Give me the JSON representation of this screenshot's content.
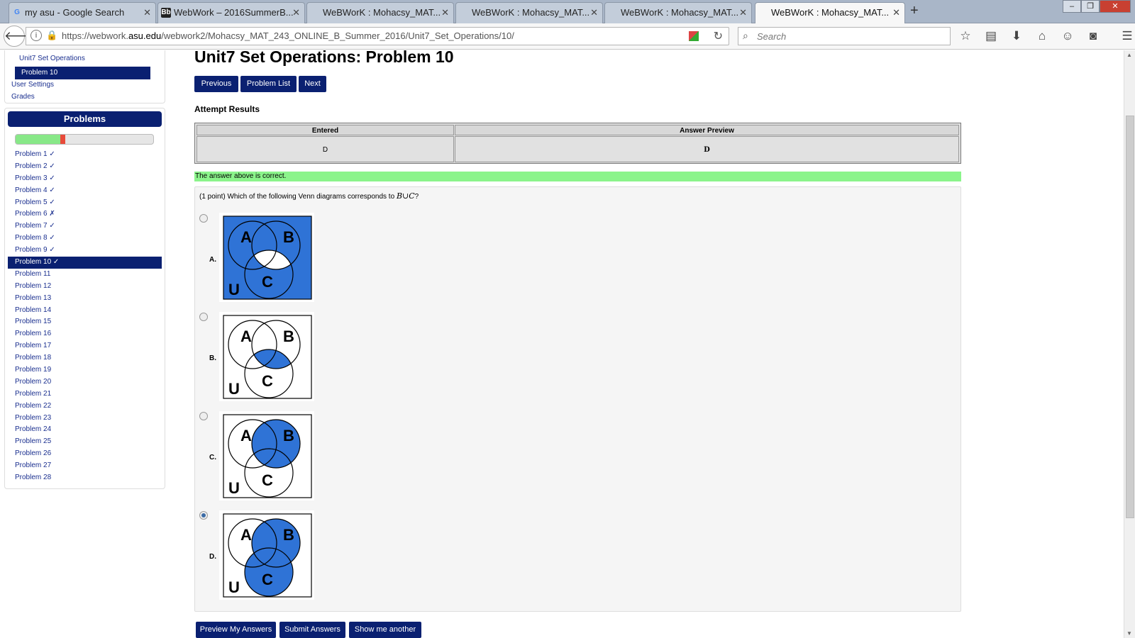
{
  "browser": {
    "tabs": [
      {
        "title": "my asu - Google Search",
        "favicon": "google-icon",
        "active": false
      },
      {
        "title": "WebWork – 2016SummerB...",
        "favicon": "blackboard-icon",
        "active": false
      },
      {
        "title": "WeBWorK : Mohacsy_MAT...",
        "favicon": "none",
        "active": false
      },
      {
        "title": "WeBWorK : Mohacsy_MAT...",
        "favicon": "none",
        "active": false
      },
      {
        "title": "WeBWorK : Mohacsy_MAT...",
        "favicon": "none",
        "active": false
      },
      {
        "title": "WeBWorK : Mohacsy_MAT...",
        "favicon": "none",
        "active": true
      }
    ],
    "url_prefix": "https://webwork.",
    "url_domain": "asu.edu",
    "url_rest": "/webwork2/Mohacsy_MAT_243_ONLINE_B_Summer_2016/Unit7_Set_Operations/10/",
    "search_placeholder": "Search"
  },
  "sidebar": {
    "set_link": "Unit7 Set Operations",
    "current_problem": "Problem 10",
    "user_settings": "User Settings",
    "grades": "Grades",
    "problems_header": "Problems",
    "progress_fraction": 0.34,
    "problems": [
      {
        "label": "Problem 1 ✓"
      },
      {
        "label": "Problem 2 ✓"
      },
      {
        "label": "Problem 3 ✓"
      },
      {
        "label": "Problem 4 ✓"
      },
      {
        "label": "Problem 5 ✓"
      },
      {
        "label": "Problem 6 ✗"
      },
      {
        "label": "Problem 7 ✓"
      },
      {
        "label": "Problem 8 ✓"
      },
      {
        "label": "Problem 9 ✓"
      },
      {
        "label": "Problem 10 ✓",
        "current": true
      },
      {
        "label": "Problem 11"
      },
      {
        "label": "Problem 12"
      },
      {
        "label": "Problem 13"
      },
      {
        "label": "Problem 14"
      },
      {
        "label": "Problem 15"
      },
      {
        "label": "Problem 16"
      },
      {
        "label": "Problem 17"
      },
      {
        "label": "Problem 18"
      },
      {
        "label": "Problem 19"
      },
      {
        "label": "Problem 20"
      },
      {
        "label": "Problem 21"
      },
      {
        "label": "Problem 22"
      },
      {
        "label": "Problem 23"
      },
      {
        "label": "Problem 24"
      },
      {
        "label": "Problem 25"
      },
      {
        "label": "Problem 26"
      },
      {
        "label": "Problem 27"
      },
      {
        "label": "Problem 28"
      }
    ]
  },
  "main": {
    "title": "Unit7 Set Operations: Problem 10",
    "nav": {
      "previous": "Previous",
      "problem_list": "Problem List",
      "next": "Next"
    },
    "attempt_heading": "Attempt Results",
    "results": {
      "col_entered": "Entered",
      "col_preview": "Answer Preview",
      "entered": "D",
      "preview": "D"
    },
    "correct_message": "The answer above is correct.",
    "question_prefix": "(1 point) Which of the following Venn diagrams corresponds to ",
    "question_math": "B∪C",
    "question_suffix": "?",
    "options": [
      {
        "label": "A.",
        "selected": false,
        "shading": "complement of B∩C"
      },
      {
        "label": "B.",
        "selected": false,
        "shading": "B∩C"
      },
      {
        "label": "C.",
        "selected": false,
        "shading": "B"
      },
      {
        "label": "D.",
        "selected": true,
        "shading": "B∪C"
      }
    ],
    "venn_labels": {
      "a": "A",
      "b": "B",
      "c": "C",
      "u": "U"
    },
    "buttons": {
      "preview": "Preview My Answers",
      "submit": "Submit Answers",
      "show": "Show me another"
    }
  },
  "colors": {
    "nav_blue": "#0a2071",
    "venn_fill": "#2f73d6",
    "correct_green": "#8bf48b"
  }
}
